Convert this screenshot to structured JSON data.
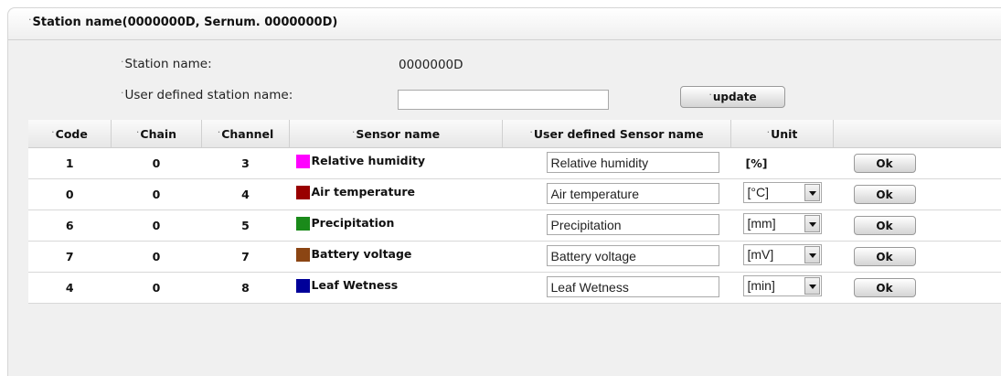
{
  "header": {
    "title": "Station name(0000000D, Sernum. 0000000D)"
  },
  "station": {
    "name_label": "Station name:",
    "name_value": "0000000D",
    "user_name_label": "User defined station name:",
    "user_name_value": "",
    "update_label": "update"
  },
  "table": {
    "columns": [
      "Code",
      "Chain",
      "Channel",
      "Sensor name",
      "User defined Sensor name",
      "Unit",
      ""
    ],
    "rows": [
      {
        "code": "1",
        "chain": "0",
        "channel": "3",
        "sensor": "Relative humidity",
        "color": "#ff00ff",
        "user_name": "Relative humidity",
        "unit": "[%]",
        "unit_select": false,
        "ok": "Ok"
      },
      {
        "code": "0",
        "chain": "0",
        "channel": "4",
        "sensor": "Air temperature",
        "color": "#990000",
        "user_name": "Air temperature",
        "unit": "[°C]",
        "unit_select": true,
        "ok": "Ok"
      },
      {
        "code": "6",
        "chain": "0",
        "channel": "5",
        "sensor": "Precipitation",
        "color": "#1a8a1a",
        "user_name": "Precipitation",
        "unit": "[mm]",
        "unit_select": true,
        "ok": "Ok"
      },
      {
        "code": "7",
        "chain": "0",
        "channel": "7",
        "sensor": "Battery voltage",
        "color": "#8b4513",
        "user_name": "Battery voltage",
        "unit": "[mV]",
        "unit_select": true,
        "ok": "Ok"
      },
      {
        "code": "4",
        "chain": "0",
        "channel": "8",
        "sensor": "Leaf Wetness",
        "color": "#000099",
        "user_name": "Leaf Wetness",
        "unit": "[min]",
        "unit_select": true,
        "ok": "Ok"
      }
    ]
  }
}
